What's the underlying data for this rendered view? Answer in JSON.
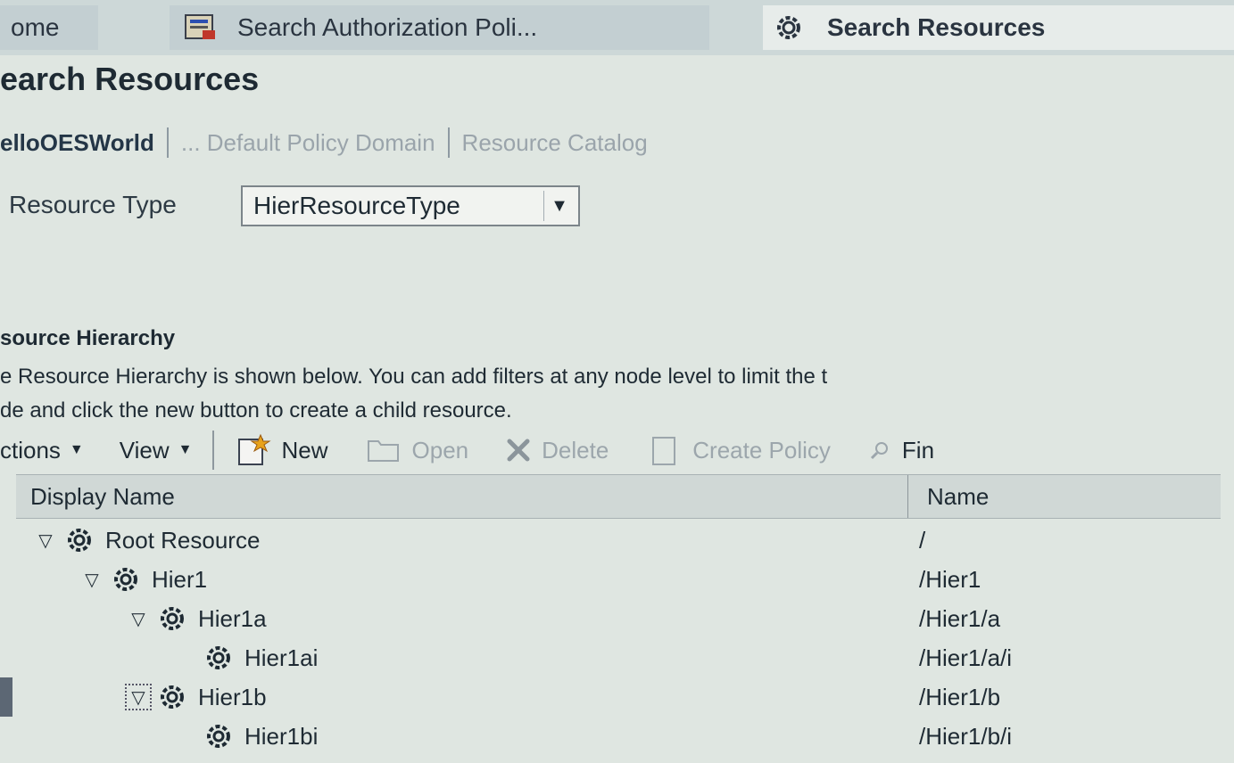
{
  "tabs": [
    {
      "label": "ome",
      "icon": "home-icon"
    },
    {
      "label": "Search Authorization Poli...",
      "icon": "policy-search-icon"
    },
    {
      "label": "Search Resources",
      "icon": "gear-icon"
    }
  ],
  "page_title": "earch Resources",
  "breadcrumb": [
    "elloOESWorld",
    "... Default Policy Domain",
    "Resource Catalog"
  ],
  "resource_type": {
    "label": "Resource Type",
    "value": "HierResourceType"
  },
  "hierarchy": {
    "title": "source Hierarchy",
    "desc_line1": "e Resource Hierarchy is shown below. You can add filters at any node level to limit the t",
    "desc_line2": "de and click the new button to create a child resource."
  },
  "toolbar": {
    "actions": "ctions",
    "view": "View",
    "new": "New",
    "open": "Open",
    "delete": "Delete",
    "create_policy": "Create Policy",
    "find": "Fin"
  },
  "table": {
    "headers": {
      "display_name": "Display Name",
      "name": "Name"
    },
    "rows": [
      {
        "display": "Root Resource",
        "name": "/"
      },
      {
        "display": "Hier1",
        "name": "/Hier1"
      },
      {
        "display": "Hier1a",
        "name": "/Hier1/a"
      },
      {
        "display": "Hier1ai",
        "name": "/Hier1/a/i"
      },
      {
        "display": "Hier1b",
        "name": "/Hier1/b"
      },
      {
        "display": "Hier1bi",
        "name": "/Hier1/b/i"
      }
    ]
  },
  "colors": {
    "background": "#dfe6e1",
    "active_tab": "#e7ecea",
    "inactive_tab": "#c3cfd2",
    "disabled_text": "#9ca6ac"
  }
}
